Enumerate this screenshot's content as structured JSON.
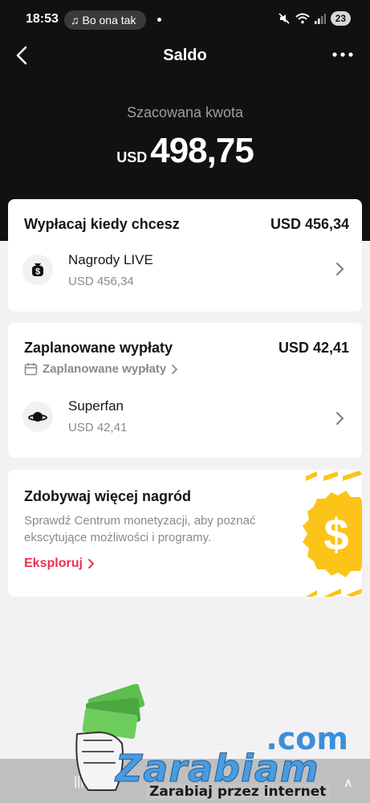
{
  "status_bar": {
    "time": "18:53",
    "media_title": "Bo ona tak",
    "battery": "23"
  },
  "nav": {
    "title": "Saldo"
  },
  "balance": {
    "label": "Szacowana kwota",
    "currency": "USD",
    "value": "498,75"
  },
  "withdraw_card": {
    "title": "Wypłacaj kiedy chcesz",
    "amount": "USD 456,34",
    "item": {
      "label": "Nagrody LIVE",
      "sub": "USD 456,34",
      "icon": "dollar-bag-icon"
    }
  },
  "scheduled_card": {
    "title": "Zaplanowane wypłaty",
    "amount": "USD 42,41",
    "link": "Zaplanowane wypłaty",
    "item": {
      "label": "Superfan",
      "sub": "USD 42,41",
      "icon": "planet-icon"
    }
  },
  "promo_card": {
    "title": "Zdobywaj więcej nagród",
    "description": "Sprawdź Centrum monetyzacji, aby poznać ekscytujące możliwości i programy.",
    "cta": "Eksploruj",
    "accent": "#e8334f",
    "coin_color": "#fcc419"
  },
  "watermark": {
    "domain": ".com",
    "brand": "Zarabiam",
    "tagline": "Zarabiaj przez internet"
  }
}
